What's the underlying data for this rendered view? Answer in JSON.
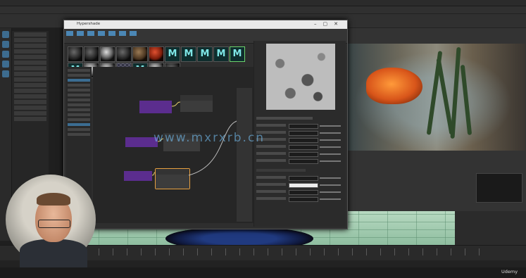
{
  "watermark": "www.mxrxrb.cn",
  "badge": "Udemy",
  "node_window": {
    "title": "Hypershade"
  },
  "colors": {
    "accent": "#4b87b5",
    "node_header": "#5b2d8e",
    "swatch_m": "#7ee6e6"
  },
  "icons": [
    "minimize-icon",
    "maximize-icon",
    "close-icon",
    "search-icon"
  ],
  "swatches": [
    {
      "kind": "dark"
    },
    {
      "kind": "dark"
    },
    {
      "kind": "ball"
    },
    {
      "kind": "dark"
    },
    {
      "kind": "brown"
    },
    {
      "kind": "red"
    },
    {
      "kind": "m",
      "label": "M"
    },
    {
      "kind": "m",
      "label": "M"
    },
    {
      "kind": "m",
      "label": "M"
    },
    {
      "kind": "m",
      "label": "M"
    },
    {
      "kind": "m",
      "label": "M",
      "sel": true
    },
    {
      "kind": "m",
      "label": "M"
    },
    {
      "kind": "ball"
    },
    {
      "kind": "ball"
    },
    {
      "kind": "checker"
    },
    {
      "kind": "m",
      "label": "M"
    },
    {
      "kind": "ball"
    },
    {
      "kind": "dark"
    }
  ]
}
